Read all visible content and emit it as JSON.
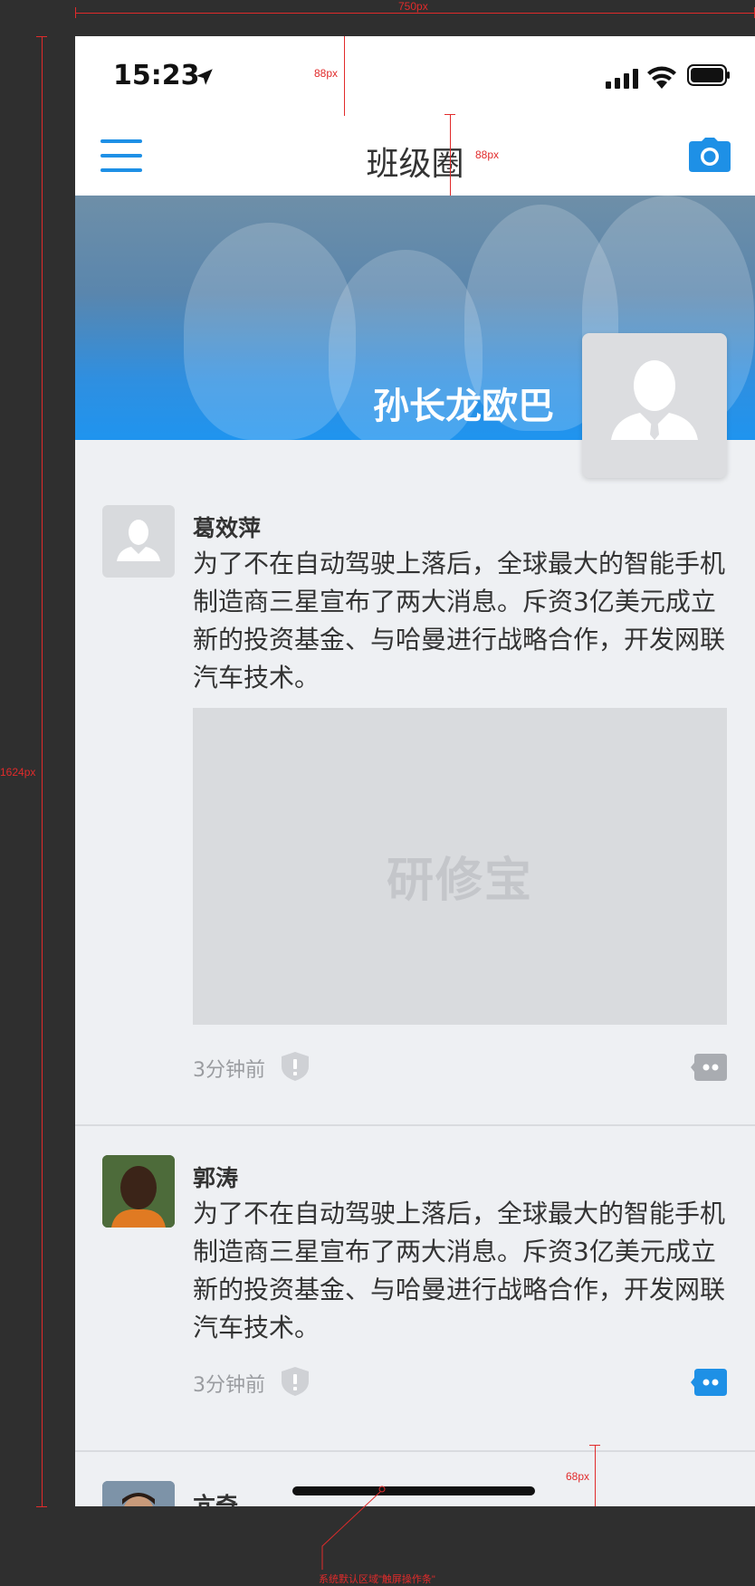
{
  "annotations": {
    "width_label": "750px",
    "height_label": "1624px",
    "statusbar_label": "88px",
    "navbar_label": "88px",
    "homebar_label": "68px",
    "homebar_note": "系统默认区域\"触屏操作条\""
  },
  "statusbar": {
    "time": "15:23"
  },
  "nav": {
    "title": "班级圈"
  },
  "hero": {
    "name": "孙长龙欧巴"
  },
  "posts": [
    {
      "author": "葛效萍",
      "text": "为了不在自动驾驶上落后，全球最大的智能手机制造商三星宣布了两大消息。斥资3亿美元成立新的投资基金、与哈曼进行战略合作，开发网联汽车技术。",
      "image_label": "研修宝",
      "time": "3分钟前"
    },
    {
      "author": "郭涛",
      "text": "为了不在自动驾驶上落后，全球最大的智能手机制造商三星宣布了两大消息。斥资3亿美元成立新的投资基金、与哈曼进行战略合作，开发网联汽车技术。",
      "time": "3分钟前"
    },
    {
      "author": "亢奇"
    }
  ],
  "colors": {
    "accent": "#1e90e6",
    "background": "#eef0f3",
    "placeholder": "#d9dbde"
  },
  "icons": [
    "menu-icon",
    "camera-icon",
    "location-arrow-icon",
    "signal-icon",
    "wifi-icon",
    "battery-icon",
    "shield-icon",
    "comment-icon",
    "default-avatar-icon"
  ]
}
